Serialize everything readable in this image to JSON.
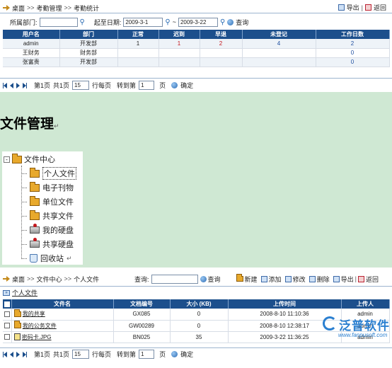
{
  "top": {
    "breadcrumb": [
      "桌面",
      "考勤管理",
      "考勤统计"
    ],
    "export_label": "导出",
    "back_label": "返回",
    "filter": {
      "dept_label": "所属部门:",
      "dept_value": "",
      "date_label": "起至日期:",
      "date_from": "2009-3-1",
      "date_to": "2009-3-22",
      "tilde": "~",
      "search_label": "查询"
    },
    "columns": [
      "用户名",
      "部门",
      "正常",
      "迟到",
      "早退",
      "未登记",
      "工作日数"
    ],
    "rows": [
      [
        "admin",
        "开发部",
        "1",
        "1",
        "2",
        "4",
        "2"
      ],
      [
        "王财务",
        "财务部",
        "",
        "",
        "",
        "",
        "0"
      ],
      [
        "张富贵",
        "开发部",
        "",
        "",
        "",
        "",
        "0"
      ]
    ],
    "pager": {
      "page_text": "第1页",
      "total_text": "共1页",
      "per_page_value": "15",
      "per_page_label": "行每页",
      "goto_label": "转到第",
      "goto_value": "1",
      "page_suffix": "页",
      "confirm_label": "确定"
    }
  },
  "section": {
    "title": "文件管理",
    "tree": {
      "root": "文件中心",
      "items": [
        "个人文件",
        "电子刊物",
        "单位文件",
        "共享文件",
        "我的硬盘",
        "共享硬盘",
        "回收站"
      ]
    }
  },
  "bottom": {
    "breadcrumb": [
      "桌面",
      "文件中心",
      "个人文件"
    ],
    "search_label": "查询:",
    "search_value": "",
    "search_btn": "查询",
    "toolbar": [
      "新建",
      "添加",
      "修改",
      "删除",
      "导出",
      "返回"
    ],
    "sub_path": "个人文件",
    "columns": [
      "文件名",
      "文档编号",
      "大小 (KB)",
      "上传时间",
      "上传人"
    ],
    "rows": [
      [
        "我的共享",
        "GX085",
        "0",
        "2008-8-10 11:10:36",
        "admin"
      ],
      [
        "我的公务文件",
        "GW00289",
        "0",
        "2008-8-10 12:38:17",
        "admin"
      ],
      [
        "密码卡.JPG",
        "BN025",
        "35",
        "2009-3-22 11:36:25",
        "admin"
      ]
    ],
    "pager": {
      "page_text": "第1页",
      "total_text": "共1页",
      "per_page_value": "15",
      "per_page_label": "行每页",
      "goto_label": "转到第",
      "goto_value": "1",
      "page_suffix": "页",
      "confirm_label": "确定"
    }
  },
  "watermark": {
    "brand": "泛普软件",
    "url": "www.fanpusoft.com"
  },
  "colors": {
    "header_blue": "#1c4f8c",
    "mid_bg": "#cfe8d3",
    "red_value": "#c4161c",
    "link_blue": "#1f4fa0"
  }
}
